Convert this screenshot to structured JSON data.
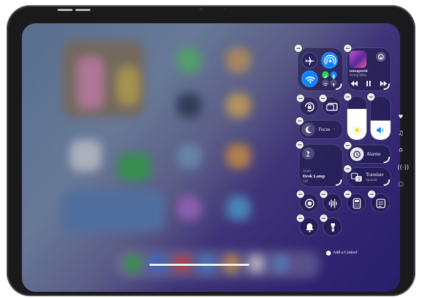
{
  "now_playing": {
    "title": "tamagotchi",
    "artist": "Young Miko"
  },
  "focus": {
    "label": "Focus"
  },
  "lamp": {
    "room": "Study",
    "name": "Desk Lamp",
    "state": "Off"
  },
  "alarms": {
    "label": "Alarms"
  },
  "translate": {
    "label": "Translate",
    "language": "Spanish"
  },
  "add_control": {
    "label": "Add a Control"
  },
  "colors": {
    "airplane_orange": "#ff9f0a",
    "connectivity_blue": "#0a84ff",
    "wifi_blue": "#0a84ff",
    "cellular_green": "#30d158",
    "accent_white": "#f2f2f7"
  },
  "icons": [
    "airplane-icon",
    "airdrop-icon",
    "wifi-icon",
    "cellular-icon",
    "bluetooth-icon",
    "vpn-icon",
    "hotspot-icon",
    "album-art-icon",
    "airplay-icon",
    "rewind-icon",
    "pause-icon",
    "forward-icon",
    "rotation-lock-icon",
    "screen-mirroring-icon",
    "moon-icon",
    "brightness-icon",
    "volume-icon",
    "lamp-icon",
    "alarm-icon",
    "translate-icon",
    "screen-record-icon",
    "voice-memo-icon",
    "calculator-icon",
    "notes-icon",
    "bell-icon",
    "flashlight-icon",
    "heart-icon",
    "music-note-icon",
    "home-icon",
    "signal-icon",
    "ring-icon"
  ]
}
